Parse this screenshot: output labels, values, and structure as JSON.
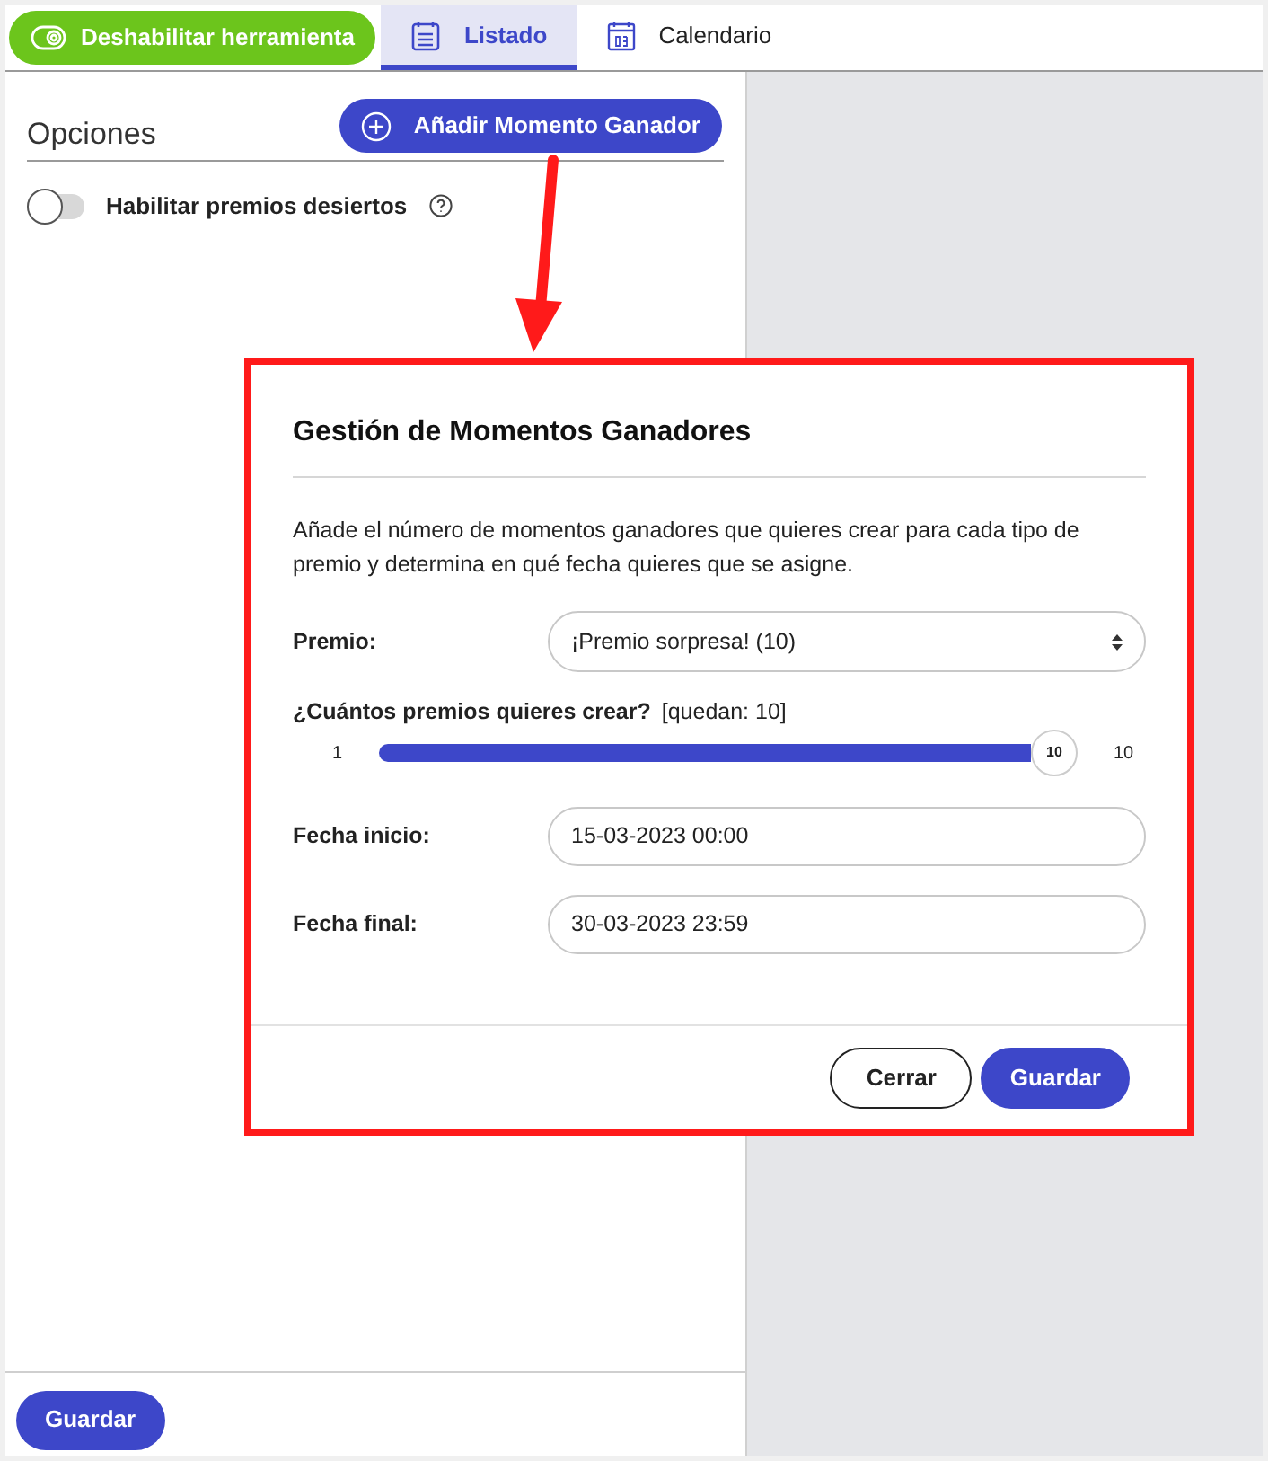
{
  "toolbar": {
    "toggle_button": {
      "label": "Deshabilitar herramienta"
    },
    "tabs": [
      {
        "label": "Listado",
        "kind": "list",
        "selected": true
      },
      {
        "label": "Calendario",
        "kind": "calendar",
        "selected": false
      }
    ]
  },
  "options": {
    "title": "Opciones",
    "add_button": "Añadir Momento Ganador",
    "switch": {
      "label": "Habilitar premios desiertos",
      "on": false
    }
  },
  "footer": {
    "save_button": "Guardar"
  },
  "dialog": {
    "title": "Gestión de Momentos Ganadores",
    "description": "Añade el número de momentos ganadores que quieres crear para cada tipo de premio y determina en qué fecha quieres que se asigne.",
    "prize": {
      "label": "Premio:",
      "value": "¡Premio sorpresa! (10)"
    },
    "quantity": {
      "label": "¿Cuántos premios quieres crear?",
      "remaining": "[quedan: 10]",
      "min": "1",
      "max": "10",
      "thumb": "10",
      "level": 1
    },
    "start": {
      "label": "Fecha inicio:",
      "value": "15-03-2023 00:00"
    },
    "end": {
      "label": "Fecha final:",
      "value": "30-03-2023 23:59"
    },
    "buttons": [
      {
        "label": "Cerrar",
        "kind": "secondary"
      },
      {
        "label": "Guardar",
        "kind": "primary"
      }
    ]
  }
}
